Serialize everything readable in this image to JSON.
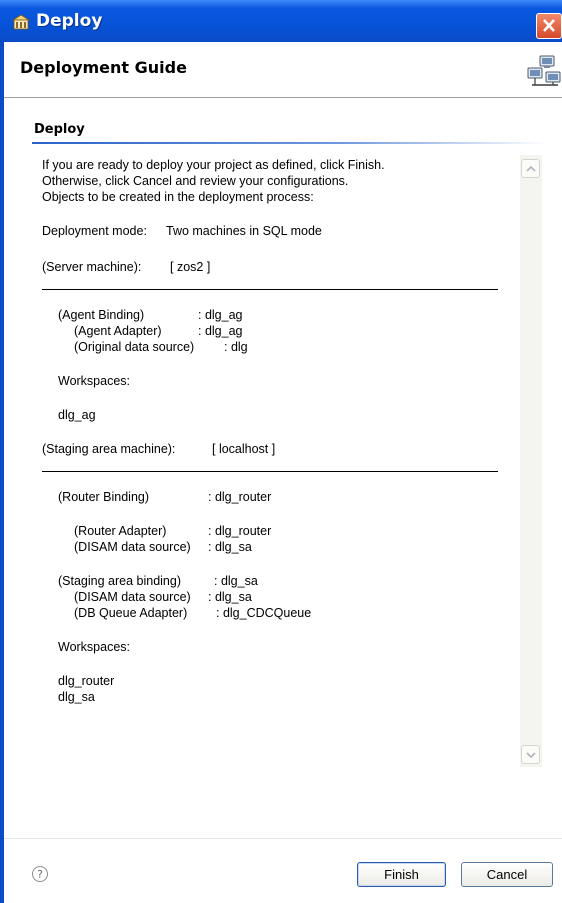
{
  "window": {
    "title": "Deploy"
  },
  "header": {
    "title": "Deployment Guide"
  },
  "section": {
    "title": "Deploy"
  },
  "content": {
    "intro_1": "If you are ready to deploy your project as defined, click Finish.",
    "intro_2": "Otherwise, click Cancel and review your configurations.",
    "intro_3": "Objects to be created in the deployment process:",
    "mode_label": "Deployment mode:",
    "mode_value": "Two machines in SQL mode",
    "server_machine_label": "(Server machine):",
    "server_machine_value": "[ zos2 ]",
    "agent_binding_label": "(Agent Binding)",
    "agent_binding_value": ": dlg_ag",
    "agent_adapter_label": "(Agent Adapter)",
    "agent_adapter_value": ": dlg_ag",
    "original_ds_label": "(Original data source)",
    "original_ds_value": ": dlg",
    "workspaces_label_1": "Workspaces:",
    "workspace_1": "dlg_ag",
    "staging_machine_label": "(Staging area machine):",
    "staging_machine_value": "[ localhost ]",
    "router_binding_label": "(Router Binding)",
    "router_binding_value": ": dlg_router",
    "router_adapter_label": "(Router Adapter)",
    "router_adapter_value": ": dlg_router",
    "disam_ds_label_1": "(DISAM data source)",
    "disam_ds_value_1": ": dlg_sa",
    "staging_binding_label": "(Staging area binding)",
    "staging_binding_value": ": dlg_sa",
    "disam_ds_label_2": "(DISAM data source)",
    "disam_ds_value_2": ": dlg_sa",
    "db_queue_label": "(DB Queue Adapter)",
    "db_queue_value": ": dlg_CDCQueue",
    "workspaces_label_2": "Workspaces:",
    "workspace_2": "dlg_router",
    "workspace_3": "dlg_sa"
  },
  "footer": {
    "help_glyph": "?",
    "finish_label": "Finish",
    "cancel_label": "Cancel"
  },
  "colors": {
    "titlebar": "#0653d8",
    "section_rule": "#2a63c8",
    "button_border": "#2b5aa6"
  }
}
